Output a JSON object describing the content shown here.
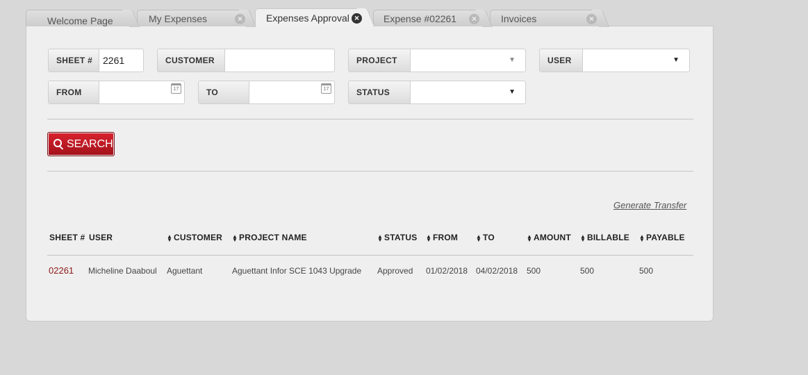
{
  "tabs": [
    {
      "label": "Welcome Page",
      "closable": false,
      "active": false
    },
    {
      "label": "My Expenses",
      "closable": true,
      "active": false
    },
    {
      "label": "Expenses Approval",
      "closable": true,
      "active": true
    },
    {
      "label": "Expense #02261",
      "closable": true,
      "active": false
    },
    {
      "label": "Invoices",
      "closable": true,
      "active": false
    }
  ],
  "filters": {
    "sheet": {
      "label": "SHEET #",
      "value": "2261"
    },
    "customer": {
      "label": "CUSTOMER",
      "value": ""
    },
    "project": {
      "label": "PROJECT",
      "value": ""
    },
    "user": {
      "label": "USER",
      "value": ""
    },
    "from": {
      "label": "FROM",
      "value": ""
    },
    "to": {
      "label": "TO",
      "value": ""
    },
    "status": {
      "label": "STATUS",
      "value": ""
    }
  },
  "search_label": "SEARCH",
  "generate_transfer": "Generate Transfer",
  "table": {
    "headers": [
      "SHEET #",
      "USER",
      "CUSTOMER",
      "PROJECT NAME",
      "STATUS",
      "FROM",
      "TO",
      "AMOUNT",
      "BILLABLE",
      "PAYABLE"
    ],
    "rows": [
      [
        "02261",
        "Micheline Daaboul",
        "Aguettant",
        "Aguettant Infor SCE 1043 Upgrade",
        "Approved",
        "01/02/2018",
        "04/02/2018",
        "500",
        "500",
        "500"
      ]
    ]
  },
  "icons": {
    "close": "close-icon",
    "calendar": "calendar-icon",
    "dropdown": "chevron-down-icon",
    "search": "search-icon",
    "sort": "sort-icon"
  },
  "colors": {
    "accent": "#c0161f",
    "link": "#8b1a1a"
  }
}
